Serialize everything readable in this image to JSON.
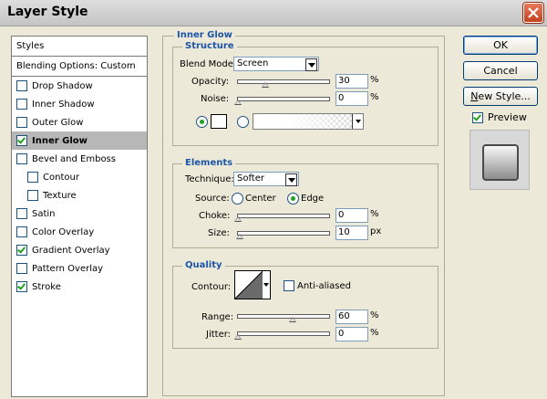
{
  "window": {
    "title": "Layer Style"
  },
  "styles": {
    "header": "Styles",
    "blending": "Blending Options: Custom",
    "items": [
      {
        "label": "Drop Shadow",
        "checked": false
      },
      {
        "label": "Inner Shadow",
        "checked": false
      },
      {
        "label": "Outer Glow",
        "checked": false
      },
      {
        "label": "Inner Glow",
        "checked": true,
        "selected": true
      },
      {
        "label": "Bevel and Emboss",
        "checked": false
      },
      {
        "label": "Contour",
        "checked": false,
        "sub": true
      },
      {
        "label": "Texture",
        "checked": false,
        "sub": true
      },
      {
        "label": "Satin",
        "checked": false
      },
      {
        "label": "Color Overlay",
        "checked": false
      },
      {
        "label": "Gradient Overlay",
        "checked": true
      },
      {
        "label": "Pattern Overlay",
        "checked": false
      },
      {
        "label": "Stroke",
        "checked": true
      }
    ]
  },
  "buttons": {
    "ok": "OK",
    "cancel": "Cancel",
    "new_style": "New Style...",
    "preview": "Preview",
    "preview_checked": true
  },
  "panel": {
    "title": "Inner Glow",
    "structure": {
      "title": "Structure",
      "blend_mode_label": "Blend Mode:",
      "blend_mode_value": "Screen",
      "opacity_label": "Opacity:",
      "opacity_value": "30",
      "opacity_unit": "%",
      "noise_label": "Noise:",
      "noise_value": "0",
      "noise_unit": "%",
      "color_mode": "solid"
    },
    "elements": {
      "title": "Elements",
      "technique_label": "Technique:",
      "technique_value": "Softer",
      "source_label": "Source:",
      "source_center": "Center",
      "source_edge": "Edge",
      "source_selected": "Edge",
      "choke_label": "Choke:",
      "choke_value": "0",
      "choke_unit": "%",
      "size_label": "Size:",
      "size_value": "10",
      "size_unit": "px"
    },
    "quality": {
      "title": "Quality",
      "contour_label": "Contour:",
      "anti_aliased_label": "Anti-aliased",
      "anti_aliased": false,
      "range_label": "Range:",
      "range_value": "60",
      "range_unit": "%",
      "jitter_label": "Jitter:",
      "jitter_value": "0",
      "jitter_unit": "%"
    }
  }
}
